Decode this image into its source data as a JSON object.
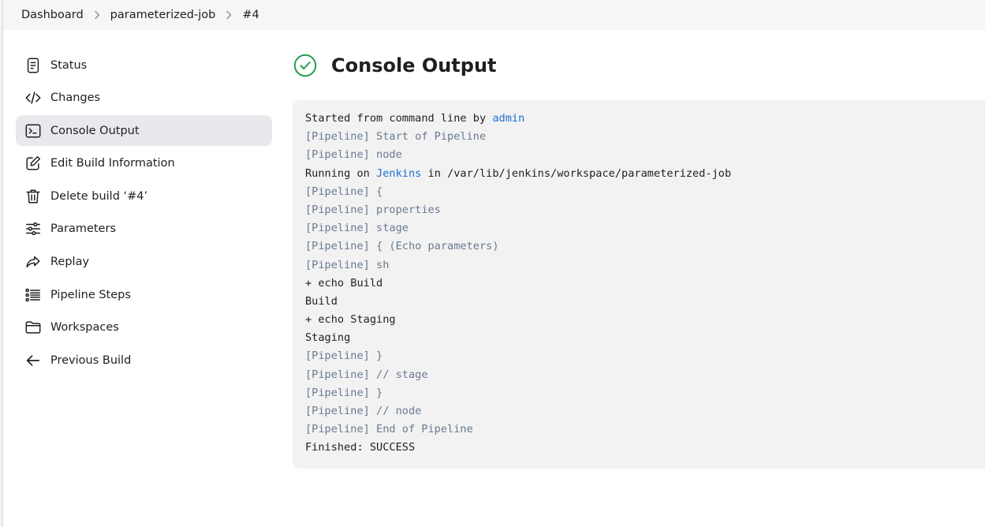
{
  "breadcrumb": {
    "items": [
      "Dashboard",
      "parameterized-job",
      "#4"
    ]
  },
  "sidebar": {
    "items": [
      {
        "label": "Status",
        "icon": "document-icon"
      },
      {
        "label": "Changes",
        "icon": "code-icon"
      },
      {
        "label": "Console Output",
        "icon": "terminal-icon",
        "active": true
      },
      {
        "label": "Edit Build Information",
        "icon": "edit-icon"
      },
      {
        "label": "Delete build ‘#4’",
        "icon": "trash-icon"
      },
      {
        "label": "Parameters",
        "icon": "sliders-icon"
      },
      {
        "label": "Replay",
        "icon": "replay-icon"
      },
      {
        "label": "Pipeline Steps",
        "icon": "list-icon"
      },
      {
        "label": "Workspaces",
        "icon": "folder-icon"
      },
      {
        "label": "Previous Build",
        "icon": "arrow-left-icon"
      }
    ]
  },
  "main": {
    "title": "Console Output",
    "status_icon": "success-check-icon",
    "status_color": "#1e9f4c"
  },
  "console": {
    "started_prefix": "Started from command line by ",
    "started_user": "admin",
    "lines_a": [
      "[Pipeline] Start of Pipeline",
      "[Pipeline] node"
    ],
    "running_prefix": "Running on ",
    "running_agent": "Jenkins",
    "running_suffix": " in /var/lib/jenkins/workspace/parameterized-job",
    "lines_b": [
      {
        "text": "[Pipeline] {",
        "pipe": true
      },
      {
        "text": "[Pipeline] properties",
        "pipe": true
      },
      {
        "text": "[Pipeline] stage",
        "pipe": true
      },
      {
        "text": "[Pipeline] { (Echo parameters)",
        "pipe": true
      },
      {
        "text": "[Pipeline] sh",
        "pipe": true
      },
      {
        "text": "+ echo Build",
        "pipe": false
      },
      {
        "text": "Build",
        "pipe": false
      },
      {
        "text": "+ echo Staging",
        "pipe": false
      },
      {
        "text": "Staging",
        "pipe": false
      },
      {
        "text": "[Pipeline] }",
        "pipe": true
      },
      {
        "text": "[Pipeline] // stage",
        "pipe": true
      },
      {
        "text": "[Pipeline] }",
        "pipe": true
      },
      {
        "text": "[Pipeline] // node",
        "pipe": true
      },
      {
        "text": "[Pipeline] End of Pipeline",
        "pipe": true
      },
      {
        "text": "Finished: SUCCESS",
        "pipe": false
      }
    ]
  },
  "colors": {
    "link": "#1d6fd1",
    "pipeline_text": "#6a7a8e",
    "active_bg": "#e9e9ed"
  }
}
